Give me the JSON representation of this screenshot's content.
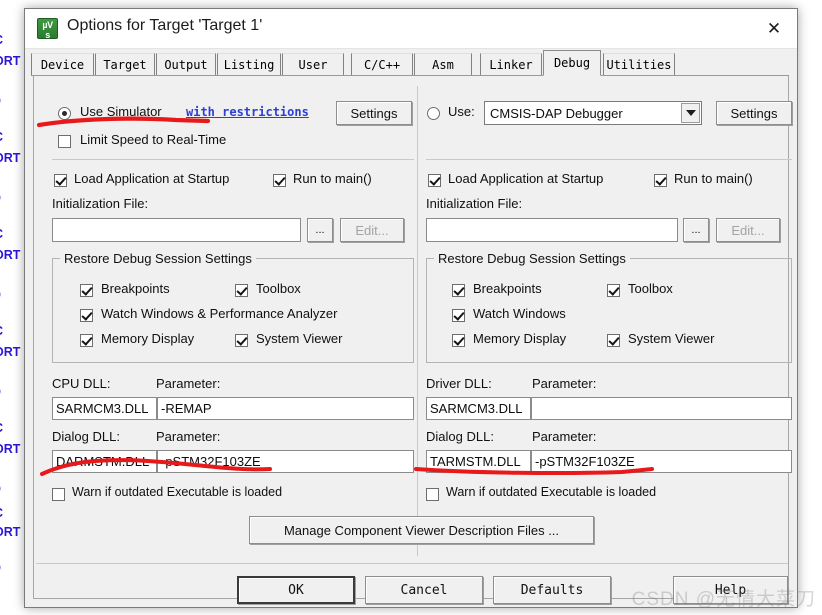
{
  "background": {
    "code_lines": [
      "C",
      "ORT",
      "p",
      "C",
      "ORT",
      "p",
      "C",
      "ORT",
      "p",
      "C",
      "ORT",
      "p",
      "C",
      "ORT",
      "p",
      "C",
      "ORT",
      "p"
    ]
  },
  "window": {
    "title": "Options for Target 'Target 1'",
    "icon_name": "keil-uvision-icon",
    "icon_line1": "µV",
    "icon_line2": "s",
    "close_label": "✕"
  },
  "tabs": [
    {
      "label": "Device",
      "active": false
    },
    {
      "label": "Target",
      "active": false
    },
    {
      "label": "Output",
      "active": false
    },
    {
      "label": "Listing",
      "active": false
    },
    {
      "label": "User",
      "active": false
    },
    {
      "label": "C/C++",
      "active": false
    },
    {
      "label": "Asm",
      "active": false
    },
    {
      "label": "Linker",
      "active": false
    },
    {
      "label": "Debug",
      "active": true
    },
    {
      "label": "Utilities",
      "active": false
    }
  ],
  "left_panel": {
    "mode_radio_label": "Use Simulator",
    "mode_radio_checked": true,
    "restrictions_link": "with restrictions",
    "settings_button": "Settings",
    "limit_speed_label": "Limit Speed to Real-Time",
    "limit_speed_checked": false,
    "load_app_label": "Load Application at Startup",
    "load_app_checked": true,
    "run_to_main_label": "Run to main()",
    "run_to_main_checked": true,
    "init_file_label": "Initialization File:",
    "init_file_value": "",
    "browse_button": "...",
    "edit_button": "Edit...",
    "restore_group_title": "Restore Debug Session Settings",
    "restore_items": [
      {
        "label": "Breakpoints",
        "checked": true
      },
      {
        "label": "Toolbox",
        "checked": true
      },
      {
        "label": "Watch Windows & Performance Analyzer",
        "checked": true
      },
      {
        "label": "Memory Display",
        "checked": true
      },
      {
        "label": "System Viewer",
        "checked": true
      }
    ],
    "cpu_dll_label": "CPU DLL:",
    "cpu_dll_value": "SARMCM3.DLL",
    "cpu_param_label": "Parameter:",
    "cpu_param_value": "-REMAP",
    "dialog_dll_label": "Dialog DLL:",
    "dialog_dll_value": "DARMSTM.DLL",
    "dialog_param_label": "Parameter:",
    "dialog_param_value": "-pSTM32F103ZE",
    "warn_label": "Warn if outdated Executable is loaded",
    "warn_checked": false
  },
  "right_panel": {
    "mode_radio_label": "Use:",
    "mode_radio_checked": false,
    "debugger_value": "CMSIS-DAP Debugger",
    "settings_button": "Settings",
    "load_app_label": "Load Application at Startup",
    "load_app_checked": true,
    "run_to_main_label": "Run to main()",
    "run_to_main_checked": true,
    "init_file_label": "Initialization File:",
    "init_file_value": "",
    "browse_button": "...",
    "edit_button": "Edit...",
    "restore_group_title": "Restore Debug Session Settings",
    "restore_items": [
      {
        "label": "Breakpoints",
        "checked": true
      },
      {
        "label": "Toolbox",
        "checked": true
      },
      {
        "label": "Watch Windows",
        "checked": true
      },
      {
        "label": "Memory Display",
        "checked": true
      },
      {
        "label": "System Viewer",
        "checked": true
      }
    ],
    "driver_dll_label": "Driver DLL:",
    "driver_dll_value": "SARMCM3.DLL",
    "driver_param_label": "Parameter:",
    "driver_param_value": "",
    "dialog_dll_label": "Dialog DLL:",
    "dialog_dll_value": "TARMSTM.DLL",
    "dialog_param_label": "Parameter:",
    "dialog_param_value": "-pSTM32F103ZE",
    "warn_label": "Warn if outdated Executable is loaded",
    "warn_checked": false
  },
  "footer": {
    "manage_button": "Manage Component Viewer Description Files ...",
    "ok_button": "OK",
    "cancel_button": "Cancel",
    "defaults_button": "Defaults",
    "help_button": "Help"
  },
  "annotations": {
    "color": "#e8191b",
    "marks": [
      "underline-use-simulator",
      "underline-dialog-dll-left",
      "underline-dialog-dll-right"
    ]
  },
  "watermark": {
    "text": "CSDN @无情大菜刀"
  }
}
